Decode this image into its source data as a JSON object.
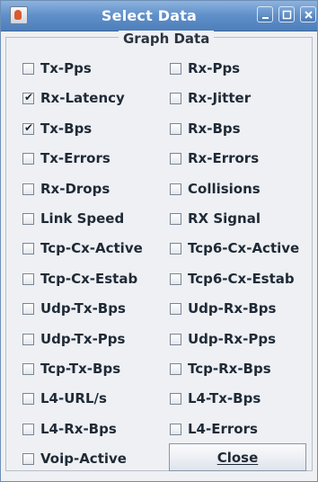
{
  "window": {
    "title": "Select Data",
    "panel_title": "Graph Data",
    "accent": "#5f8fc8"
  },
  "checkboxes": [
    {
      "label": "Tx-Pps",
      "checked": false
    },
    {
      "label": "Rx-Pps",
      "checked": false
    },
    {
      "label": "Rx-Latency",
      "checked": true
    },
    {
      "label": "Rx-Jitter",
      "checked": false
    },
    {
      "label": "Tx-Bps",
      "checked": true
    },
    {
      "label": "Rx-Bps",
      "checked": false
    },
    {
      "label": "Tx-Errors",
      "checked": false
    },
    {
      "label": "Rx-Errors",
      "checked": false
    },
    {
      "label": "Rx-Drops",
      "checked": false
    },
    {
      "label": "Collisions",
      "checked": false
    },
    {
      "label": "Link Speed",
      "checked": false
    },
    {
      "label": "RX Signal",
      "checked": false
    },
    {
      "label": "Tcp-Cx-Active",
      "checked": false
    },
    {
      "label": "Tcp6-Cx-Active",
      "checked": false
    },
    {
      "label": "Tcp-Cx-Estab",
      "checked": false
    },
    {
      "label": "Tcp6-Cx-Estab",
      "checked": false
    },
    {
      "label": "Udp-Tx-Bps",
      "checked": false
    },
    {
      "label": "Udp-Rx-Bps",
      "checked": false
    },
    {
      "label": "Udp-Tx-Pps",
      "checked": false
    },
    {
      "label": "Udp-Rx-Pps",
      "checked": false
    },
    {
      "label": "Tcp-Tx-Bps",
      "checked": false
    },
    {
      "label": "Tcp-Rx-Bps",
      "checked": false
    },
    {
      "label": "L4-URL/s",
      "checked": false
    },
    {
      "label": "L4-Tx-Bps",
      "checked": false
    },
    {
      "label": "L4-Rx-Bps",
      "checked": false
    },
    {
      "label": "L4-Errors",
      "checked": false
    },
    {
      "label": "Voip-Active",
      "checked": false
    }
  ],
  "close_button": {
    "label": "Close"
  }
}
